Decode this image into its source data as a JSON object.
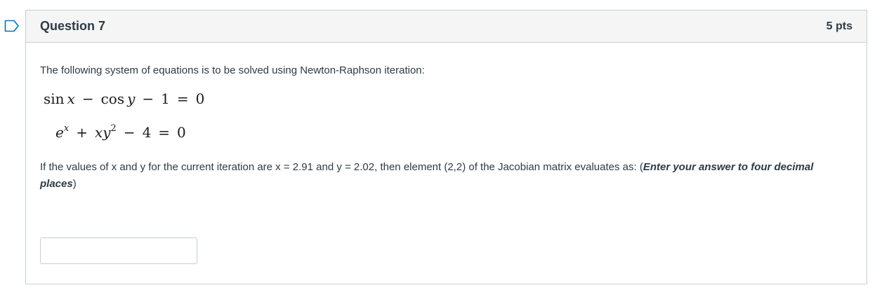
{
  "question": {
    "title": "Question 7",
    "points": "5 pts",
    "intro": "The following system of equations is to be solved using Newton-Raphson iteration:",
    "equations": [
      "sin x − cos y − 1 = 0",
      "e^x + xy^2 − 4 = 0"
    ],
    "prompt_text": "If the values of x and y for the current iteration are x = 2.91 and y = 2.02, then element (2,2) of the Jacobian matrix evaluates as: (",
    "prompt_emphasis": "Enter your answer to four decimal places",
    "prompt_close": ")",
    "answer": {
      "value": "",
      "placeholder": ""
    }
  },
  "colors": {
    "header_bg": "#f5f5f5",
    "border": "#c7cdd1",
    "text": "#2d3b45",
    "flag_accent": "#0374b5"
  },
  "icons": {
    "flag": "bookmark-flag-icon"
  }
}
